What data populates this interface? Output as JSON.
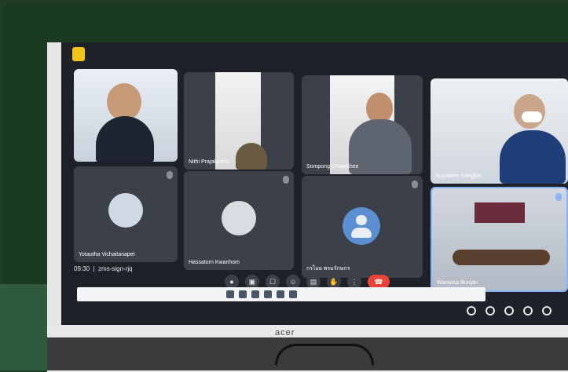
{
  "meeting": {
    "time": "09:30",
    "code": "zms-sign-rjq"
  },
  "participants": [
    {
      "name": ""
    },
    {
      "name": "Nithi Prajakpiens"
    },
    {
      "name": "Sompong Chaiwithee"
    },
    {
      "name": "Supaporn Sangbal"
    },
    {
      "name": "Yotautha Vichaitanapet"
    },
    {
      "name": "Hassatorn Kwanhom"
    },
    {
      "name": "กรไอย พรมรักษกร"
    },
    {
      "name": "Wanwisa Bunjan"
    }
  ],
  "monitor": {
    "brand": "acer"
  },
  "colors": {
    "accent_end_call": "#ea4335",
    "tile_bg": "#3c4048",
    "screen_bg": "#1e2127"
  },
  "icons": {
    "controls": [
      "mic-icon",
      "camera-icon",
      "captions-icon",
      "emoji-icon",
      "present-icon",
      "raise-hand-icon",
      "more-icon",
      "end-call-icon"
    ],
    "right": [
      "info-icon",
      "people-icon",
      "chat-icon",
      "activities-icon",
      "lock-icon"
    ]
  }
}
